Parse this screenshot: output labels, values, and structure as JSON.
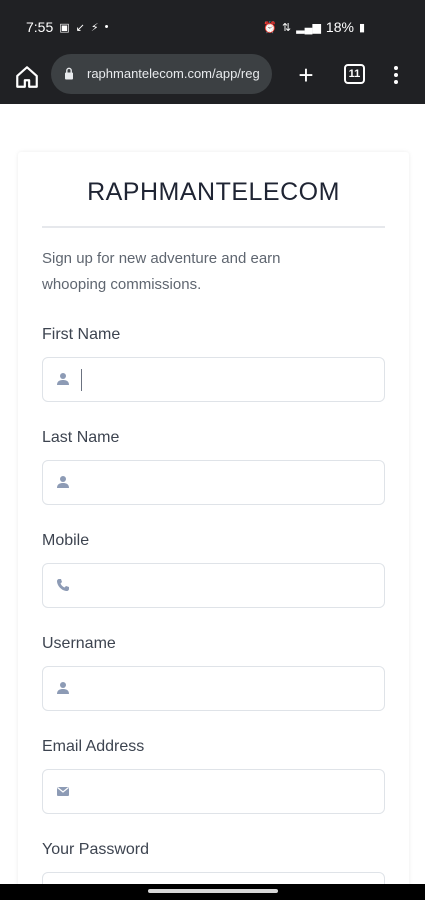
{
  "status_bar": {
    "time": "7:55",
    "battery": "18%"
  },
  "browser": {
    "url": "raphmantelecom.com/app/reg",
    "tab_count": "11"
  },
  "page": {
    "brand": "RAPHMANTELECOM",
    "intro": "Sign up for new adventure and earn whooping commissions.",
    "fields": [
      {
        "label": "First Name",
        "icon": "user-icon",
        "value": ""
      },
      {
        "label": "Last Name",
        "icon": "user-icon",
        "value": ""
      },
      {
        "label": "Mobile",
        "icon": "phone-icon",
        "value": ""
      },
      {
        "label": "Username",
        "icon": "user-icon",
        "value": ""
      },
      {
        "label": "Email Address",
        "icon": "envelope-icon",
        "value": ""
      },
      {
        "label": "Your Password",
        "icon": "lock-icon",
        "value": ""
      }
    ]
  },
  "colors": {
    "chrome_bg": "#202124",
    "url_bar_bg": "#3c4043",
    "icon_color": "#8d9bb5",
    "label_color": "#3d4450"
  }
}
